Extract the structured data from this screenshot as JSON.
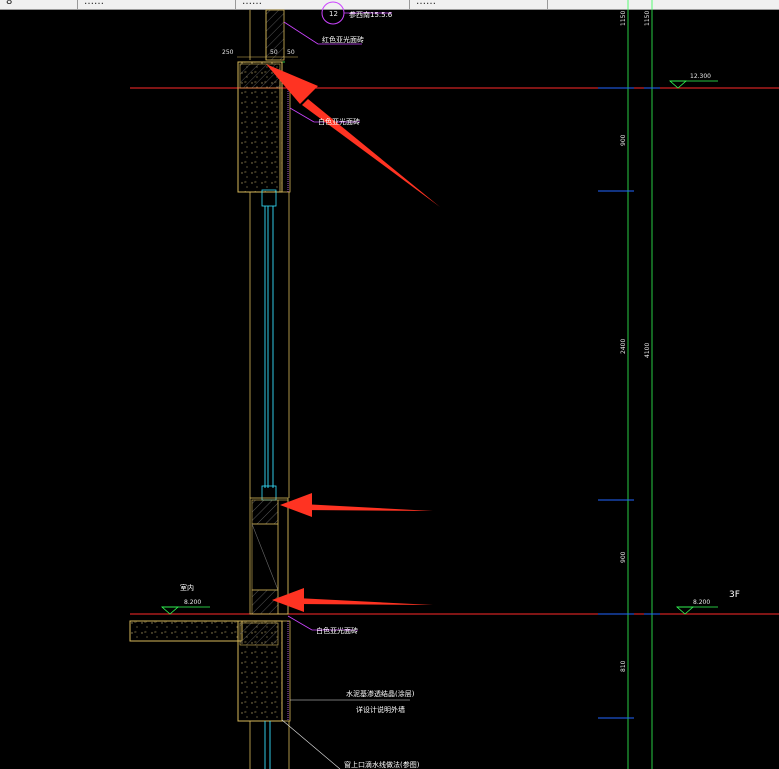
{
  "tabs": [
    {
      "label": "8"
    },
    {
      "label": "……"
    },
    {
      "label": "……"
    },
    {
      "label": "……"
    }
  ],
  "drawing": {
    "callout": {
      "number": "12",
      "ref": "参西南15.5.6"
    },
    "dims_top": {
      "left": "250",
      "mid": "50",
      "right": "50"
    },
    "vertical_dims": {
      "d1150a": "1150",
      "d1150b": "1150",
      "d900": "900",
      "d2400": "2400",
      "d4100": "4100",
      "d900b": "900",
      "d810": "810"
    },
    "levels": {
      "upper": "12.300",
      "right_lower": "8.200",
      "left_lower": "8.200",
      "floor_tag": "3F"
    },
    "labels": {
      "red_paint_top": "红色亚光面砖",
      "white_paint_mid": "白色亚光面砖",
      "white_paint_low": "白色亚光面砖",
      "indoor": "室内",
      "waterproof_1": "水泥基渗透结晶(涂层)",
      "waterproof_2": "详设计说明外墙",
      "bottom_note": "窗上口滴水线做法(参图)"
    }
  },
  "colors": {
    "red_line": "#ff2a2a",
    "green_line": "#33ff55",
    "blue_tick": "#2266ff",
    "concrete": "#d6b85a",
    "glass": "#35e0ff",
    "arrow": "#ff3322"
  }
}
